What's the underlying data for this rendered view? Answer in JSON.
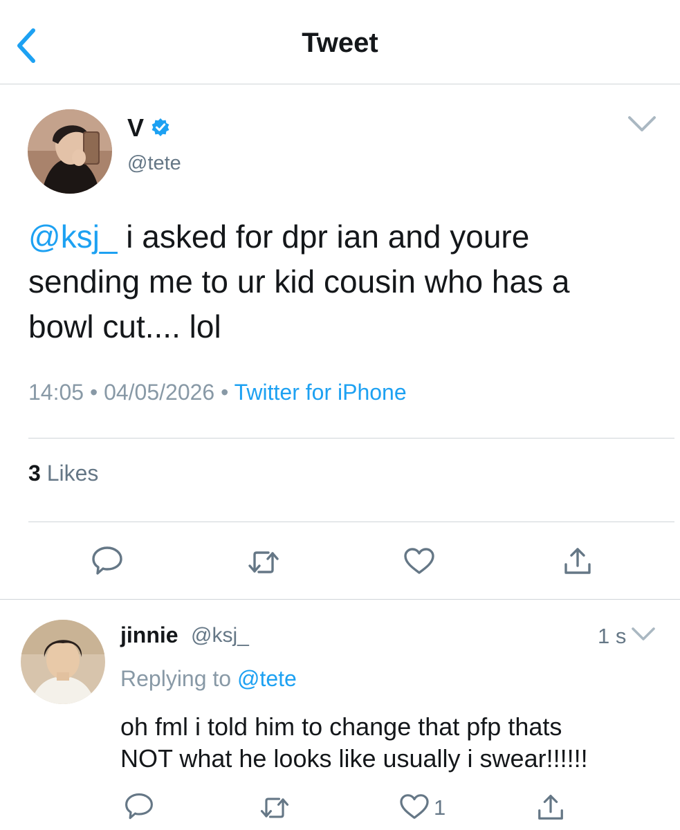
{
  "header": {
    "title": "Tweet"
  },
  "tweet": {
    "display_name": "V",
    "handle": "@tete",
    "mention": "@ksj_",
    "text_line1": " i asked for dpr ian and youre",
    "text_line2": "sending me to ur kid cousin who has a",
    "text_line3": "bowl cut.... lol",
    "time": "14:05",
    "separator": " • ",
    "date": "04/05/2026",
    "source": "Twitter for iPhone",
    "likes_count": "3",
    "likes_label": " Likes"
  },
  "reply": {
    "display_name": "jinnie",
    "handle": "@ksj_",
    "time": "1 s",
    "replying_prefix": "Replying to ",
    "replying_to": "@tete",
    "text_line1": "oh fml i told him to change that pfp thats",
    "text_line2": "NOT what he looks like usually i swear!!!!!!",
    "like_count": "1"
  },
  "colors": {
    "accent": "#1da1f2",
    "secondary_text": "#657786",
    "divider": "#cfd4d8"
  },
  "icons": {
    "back": "chevron-left-icon",
    "verified": "verified-badge-icon",
    "more": "chevron-down-icon",
    "reply": "reply-icon",
    "retweet": "retweet-icon",
    "like": "heart-icon",
    "share": "share-icon"
  }
}
